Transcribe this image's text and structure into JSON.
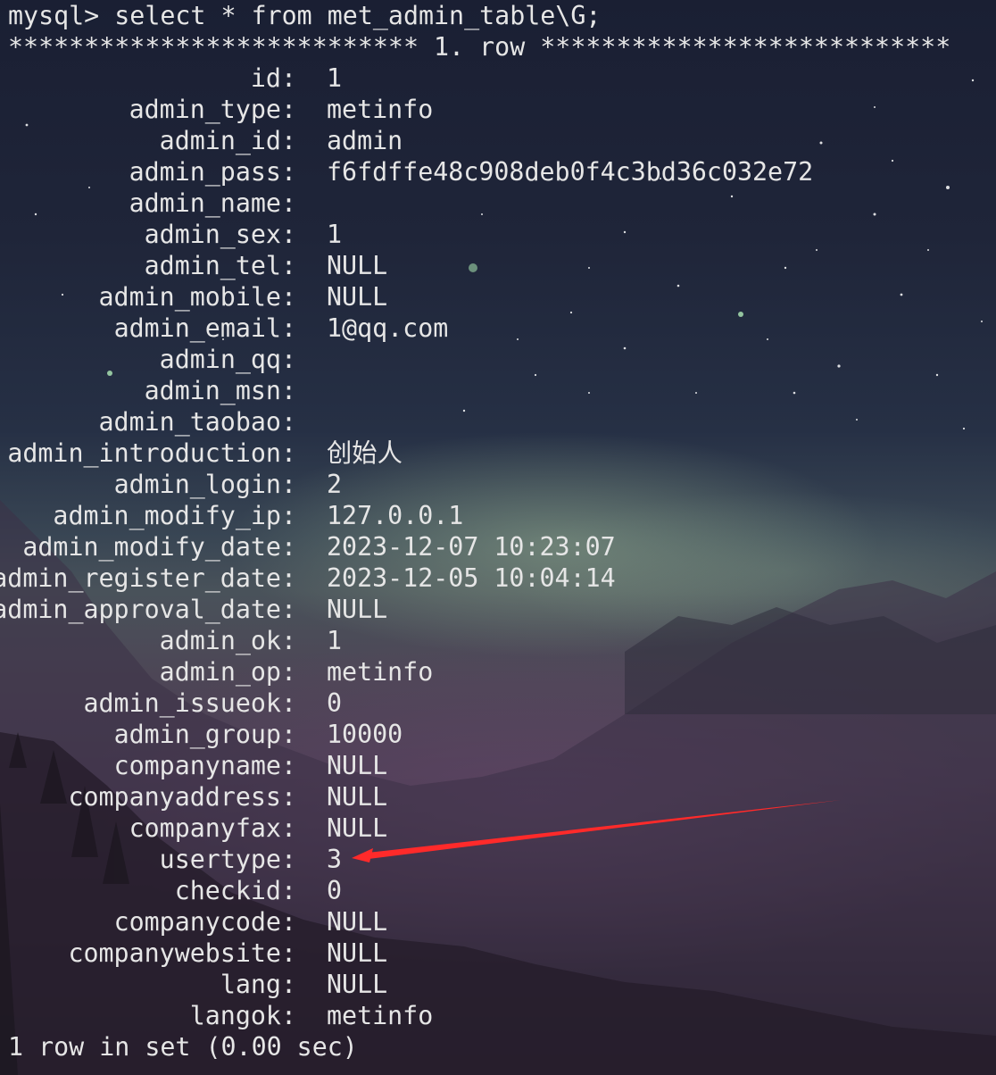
{
  "terminal": {
    "command": "mysql> select * from met_admin_table\\G;",
    "row_header": "*************************** 1. row ***************************",
    "fields": [
      {
        "name": "id:",
        "value": "1"
      },
      {
        "name": "admin_type:",
        "value": "metinfo"
      },
      {
        "name": "admin_id:",
        "value": "admin"
      },
      {
        "name": "admin_pass:",
        "value": "f6fdffe48c908deb0f4c3bd36c032e72"
      },
      {
        "name": "admin_name:",
        "value": ""
      },
      {
        "name": "admin_sex:",
        "value": "1"
      },
      {
        "name": "admin_tel:",
        "value": "NULL"
      },
      {
        "name": "admin_mobile:",
        "value": "NULL"
      },
      {
        "name": "admin_email:",
        "value": "1@qq.com"
      },
      {
        "name": "admin_qq:",
        "value": ""
      },
      {
        "name": "admin_msn:",
        "value": ""
      },
      {
        "name": "admin_taobao:",
        "value": ""
      },
      {
        "name": "admin_introduction:",
        "value": "创始人"
      },
      {
        "name": "admin_login:",
        "value": "2"
      },
      {
        "name": "admin_modify_ip:",
        "value": "127.0.0.1"
      },
      {
        "name": "admin_modify_date:",
        "value": "2023-12-07 10:23:07"
      },
      {
        "name": "admin_register_date:",
        "value": "2023-12-05 10:04:14"
      },
      {
        "name": "admin_approval_date:",
        "value": "NULL"
      },
      {
        "name": "admin_ok:",
        "value": "1"
      },
      {
        "name": "admin_op:",
        "value": "metinfo"
      },
      {
        "name": "admin_issueok:",
        "value": "0"
      },
      {
        "name": "admin_group:",
        "value": "10000"
      },
      {
        "name": "companyname:",
        "value": "NULL"
      },
      {
        "name": "companyaddress:",
        "value": "NULL"
      },
      {
        "name": "companyfax:",
        "value": "NULL"
      },
      {
        "name": "usertype:",
        "value": "3"
      },
      {
        "name": "checkid:",
        "value": "0"
      },
      {
        "name": "companycode:",
        "value": "NULL"
      },
      {
        "name": "companywebsite:",
        "value": "NULL"
      },
      {
        "name": "lang:",
        "value": "NULL"
      },
      {
        "name": "langok:",
        "value": "metinfo"
      }
    ],
    "footer": "1 row in set (0.00 sec)"
  },
  "colors": {
    "text": "#e6e6e6",
    "arrow": "#ff2a2a"
  },
  "icons": {
    "annotation": "red-arrow-icon"
  }
}
